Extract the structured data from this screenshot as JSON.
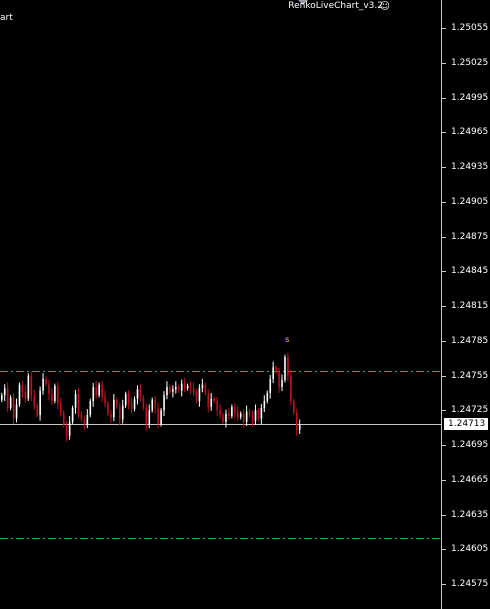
{
  "window": {
    "symbol_fragment": "art"
  },
  "indicator": {
    "title": "RenkoLiveChart_v3.2",
    "icon": "smiley-icon",
    "icon_glyph": "☺"
  },
  "signal": {
    "label": "s",
    "color": "#ffd700"
  },
  "price_axis": {
    "labels": [
      "1.25055",
      "1.25025",
      "1.24995",
      "1.24965",
      "1.24935",
      "1.24905",
      "1.24875",
      "1.24845",
      "1.24815",
      "1.24785",
      "1.24755",
      "1.24725",
      "1.24695",
      "1.24665",
      "1.24635",
      "1.24605",
      "1.24575"
    ],
    "current_price": "1.24713"
  },
  "colors": {
    "background": "#000000",
    "bull_candle": "#ffffff",
    "bear_candle": "#c0141e",
    "level_line": "#22b14c",
    "current_price_line": "#c8c8c8"
  },
  "chart_data": {
    "type": "candlestick",
    "ylim": [
      1.24555,
      1.25075
    ],
    "levels": [
      1.24759,
      1.24615
    ],
    "current_price": 1.24713,
    "closes": [
      1.24738,
      1.24744,
      1.24727,
      1.24736,
      1.24718,
      1.2473,
      1.24747,
      1.24741,
      1.24735,
      1.24755,
      1.24738,
      1.24729,
      1.24721,
      1.24742,
      1.24752,
      1.24748,
      1.24739,
      1.24733,
      1.24746,
      1.24731,
      1.24723,
      1.24712,
      1.24703,
      1.24715,
      1.24727,
      1.24739,
      1.24722,
      1.24717,
      1.24713,
      1.24721,
      1.24733,
      1.24745,
      1.24738,
      1.24747,
      1.24737,
      1.24731,
      1.24722,
      1.24719,
      1.24734,
      1.24728,
      1.24717,
      1.24729,
      1.24739,
      1.24731,
      1.24726,
      1.24735,
      1.24743,
      1.24736,
      1.24727,
      1.24713,
      1.24725,
      1.24734,
      1.24727,
      1.24713,
      1.24725,
      1.24738,
      1.24745,
      1.24741,
      1.24743,
      1.24745,
      1.24742,
      1.24748,
      1.24744,
      1.24746,
      1.24744,
      1.24741,
      1.24733,
      1.24744,
      1.24747,
      1.2474,
      1.24728,
      1.24735,
      1.24733,
      1.24725,
      1.24721,
      1.24715,
      1.24722,
      1.2472,
      1.24728,
      1.24723,
      1.24719,
      1.24722,
      1.24715,
      1.24724,
      1.24721,
      1.24716,
      1.24725,
      1.24718,
      1.24727,
      1.24733,
      1.2474,
      1.24752,
      1.24762,
      1.24758,
      1.24745,
      1.24751,
      1.24771,
      1.24755,
      1.24733,
      1.24723,
      1.24708,
      1.24712
    ]
  }
}
